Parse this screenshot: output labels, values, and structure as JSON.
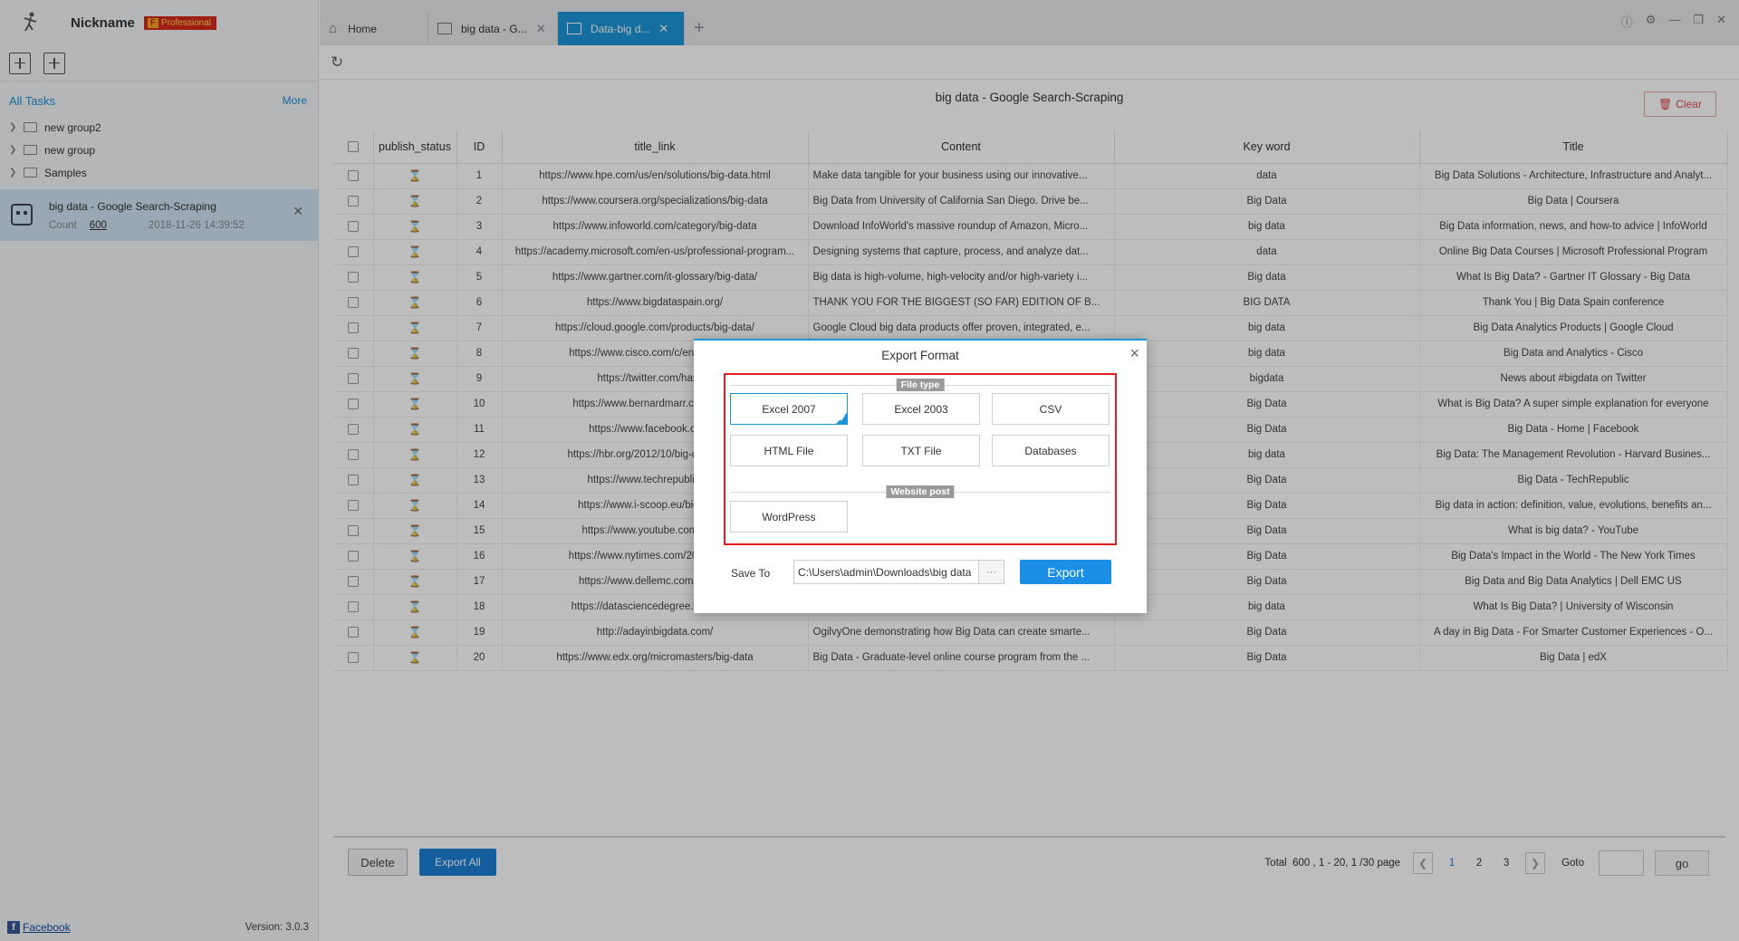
{
  "app": {
    "nickname": "Nickname",
    "badge_letter": "F",
    "badge": "Professional",
    "version": "Version: 3.0.3",
    "facebook": "Facebook"
  },
  "sidebar": {
    "all_tasks": "All Tasks",
    "more": "More",
    "groups": [
      {
        "label": "new group2"
      },
      {
        "label": "new group"
      },
      {
        "label": "Samples"
      }
    ],
    "task": {
      "title": "big data - Google Search-Scraping",
      "count_label": "Count",
      "count_value": "600",
      "date": "2018-11-26 14:39:52"
    }
  },
  "tabs": [
    {
      "label": "Home"
    },
    {
      "label": "big data - G..."
    },
    {
      "label": "Data-big d..."
    }
  ],
  "page": {
    "title": "big data - Google Search-Scraping",
    "clear": "Clear"
  },
  "table": {
    "headers": [
      "publish_status",
      "ID",
      "title_link",
      "Content",
      "Key word",
      "Title"
    ],
    "rows": [
      {
        "id": "1",
        "link": "https://www.hpe.com/us/en/solutions/big-data.html",
        "content": "Make data tangible for your business using our innovative...",
        "keyword": "data",
        "title": "Big Data Solutions - Architecture, Infrastructure and Analyt..."
      },
      {
        "id": "2",
        "link": "https://www.coursera.org/specializations/big-data",
        "content": "Big Data from University of California San Diego. Drive be...",
        "keyword": "Big Data",
        "title": "Big Data | Coursera"
      },
      {
        "id": "3",
        "link": "https://www.infoworld.com/category/big-data",
        "content": "Download InfoWorld's massive roundup of Amazon, Micro...",
        "keyword": "big data",
        "title": "Big Data information, news, and how-to advice | InfoWorld"
      },
      {
        "id": "4",
        "link": "https://academy.microsoft.com/en-us/professional-program...",
        "content": "Designing systems that capture, process, and analyze dat...",
        "keyword": "data",
        "title": "Online Big Data Courses | Microsoft Professional Program"
      },
      {
        "id": "5",
        "link": "https://www.gartner.com/it-glossary/big-data/",
        "content": "Big data is high-volume, high-velocity and/or high-variety i...",
        "keyword": "Big data",
        "title": "What Is Big Data? - Gartner IT Glossary - Big Data"
      },
      {
        "id": "6",
        "link": "https://www.bigdataspain.org/",
        "content": "THANK YOU FOR THE BIGGEST (SO FAR) EDITION OF B...",
        "keyword": "BIG DATA",
        "title": "Thank You | Big Data Spain conference"
      },
      {
        "id": "7",
        "link": "https://cloud.google.com/products/big-data/",
        "content": "Google Cloud big data products offer proven, integrated, e...",
        "keyword": "big data",
        "title": "Big Data Analytics Products | Google Cloud"
      },
      {
        "id": "8",
        "link": "https://www.cisco.com/c/en/us/solutio",
        "content": "",
        "keyword": "big data",
        "title": "Big Data and Analytics - Cisco"
      },
      {
        "id": "9",
        "link": "https://twitter.com/hashta",
        "content": "",
        "keyword": "bigdata",
        "title": "News about #bigdata on Twitter"
      },
      {
        "id": "10",
        "link": "https://www.bernardmarr.com/defau",
        "content": "",
        "keyword": "Big Data",
        "title": "What is Big Data? A super simple explanation for everyone"
      },
      {
        "id": "11",
        "link": "https://www.facebook.com/bi",
        "content": "",
        "keyword": "Big Data",
        "title": "Big Data - Home | Facebook"
      },
      {
        "id": "12",
        "link": "https://hbr.org/2012/10/big-data-the-m",
        "content": "",
        "keyword": "big data",
        "title": "Big Data: The Management Revolution - Harvard Busines..."
      },
      {
        "id": "13",
        "link": "https://www.techrepublic.com",
        "content": "",
        "keyword": "Big Data",
        "title": "Big Data - TechRepublic"
      },
      {
        "id": "14",
        "link": "https://www.i-scoop.eu/big-data-a",
        "content": "",
        "keyword": "Big Data",
        "title": "Big data in action: definition, value, evolutions, benefits an..."
      },
      {
        "id": "15",
        "link": "https://www.youtube.com/watch",
        "content": "",
        "keyword": "Big Data",
        "title": "What is big data? - YouTube"
      },
      {
        "id": "16",
        "link": "https://www.nytimes.com/2012/02/12/",
        "content": "",
        "keyword": "Big Data",
        "title": "Big Data's Impact in the World - The New York Times"
      },
      {
        "id": "17",
        "link": "https://www.dellemc.com/en-us/b",
        "content": "",
        "keyword": "Big Data",
        "title": "Big Data and Big Data Analytics | Dell EMC US"
      },
      {
        "id": "18",
        "link": "https://datasciencedegree.wisconsin",
        "content": "",
        "keyword": "big data",
        "title": "What Is Big Data? | University of Wisconsin"
      },
      {
        "id": "19",
        "link": "http://adayinbigdata.com/",
        "content": "OgilvyOne demonstrating how Big Data can create smarte...",
        "keyword": "Big Data",
        "title": "A day in Big Data - For Smarter Customer Experiences - O..."
      },
      {
        "id": "20",
        "link": "https://www.edx.org/micromasters/big-data",
        "content": "Big Data - Graduate-level online course program from the ...",
        "keyword": "Big Data",
        "title": "Big Data | edX"
      }
    ]
  },
  "bottom": {
    "delete": "Delete",
    "export_all": "Export All",
    "total_label": "Total",
    "total_value": "600",
    "range": "1 - 20,",
    "page_info": "1 /30 page",
    "pages": [
      "1",
      "2",
      "3"
    ],
    "goto": "Goto",
    "go": "go"
  },
  "dialog": {
    "title": "Export Format",
    "file_type_label": "File type",
    "file_types": [
      "Excel 2007",
      "Excel 2003",
      "CSV",
      "HTML File",
      "TXT File",
      "Databases"
    ],
    "selected": "Excel 2007",
    "website_post_label": "Website post",
    "website_posts": [
      "WordPress"
    ],
    "save_to_label": "Save To",
    "save_path": "C:\\Users\\admin\\Downloads\\big data",
    "browse": "···",
    "export": "Export",
    "highlight_color": "#e11e1e",
    "accent_color": "#1b95d8"
  }
}
